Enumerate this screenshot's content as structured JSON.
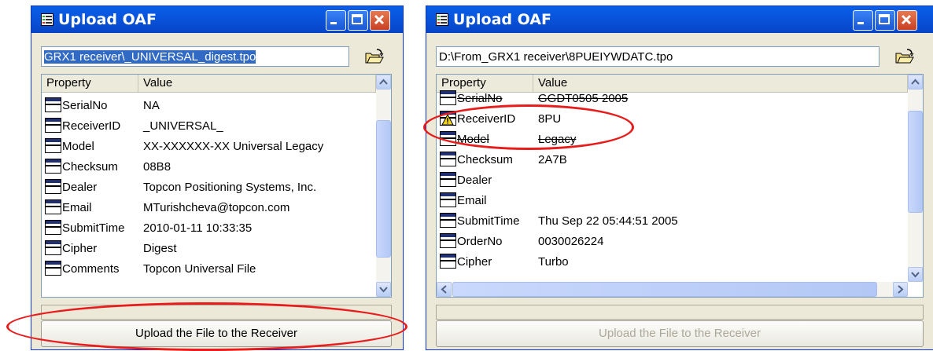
{
  "left_window": {
    "title": "Upload OAF",
    "file_path": "GRX1 receiver\\_UNIVERSAL_digest.tpo",
    "columns": [
      "Property",
      "Value"
    ],
    "rows": [
      {
        "property": "SerialNo",
        "value": "NA"
      },
      {
        "property": "ReceiverID",
        "value": "_UNIVERSAL_"
      },
      {
        "property": "Model",
        "value": "XX-XXXXXX-XX Universal Legacy"
      },
      {
        "property": "Checksum",
        "value": "08B8"
      },
      {
        "property": "Dealer",
        "value": "Topcon Positioning Systems, Inc."
      },
      {
        "property": "Email",
        "value": "MTurishcheva@topcon.com"
      },
      {
        "property": "SubmitTime",
        "value": "2010-01-11 10:33:35"
      },
      {
        "property": "Cipher",
        "value": "Digest"
      },
      {
        "property": "Comments",
        "value": "Topcon Universal File"
      }
    ],
    "upload_label": "Upload the File to the Receiver"
  },
  "right_window": {
    "title": "Upload OAF",
    "file_path": "D:\\From_GRX1 receiver\\8PUEIYWDATC.tpo",
    "columns": [
      "Property",
      "Value"
    ],
    "rows": [
      {
        "property": "SerialNo",
        "value": "GGDT0505 2005"
      },
      {
        "property": "ReceiverID",
        "value": "8PU"
      },
      {
        "property": "Model",
        "value": "Legacy"
      },
      {
        "property": "Checksum",
        "value": "2A7B"
      },
      {
        "property": "Dealer",
        "value": ""
      },
      {
        "property": "Email",
        "value": ""
      },
      {
        "property": "SubmitTime",
        "value": "Thu Sep 22 05:44:51 2005"
      },
      {
        "property": "OrderNo",
        "value": "0030026224"
      },
      {
        "property": "Cipher",
        "value": "Turbo"
      }
    ],
    "upload_label": "Upload the File to the Receiver"
  },
  "colors": {
    "highlight": "#e81c1c",
    "titlebar": "#0855dd",
    "selection": "#316ac5"
  },
  "icons": [
    "grid-app-icon",
    "minimize-icon",
    "maximize-icon",
    "close-icon",
    "open-folder-icon",
    "property-icon",
    "warning-icon"
  ]
}
